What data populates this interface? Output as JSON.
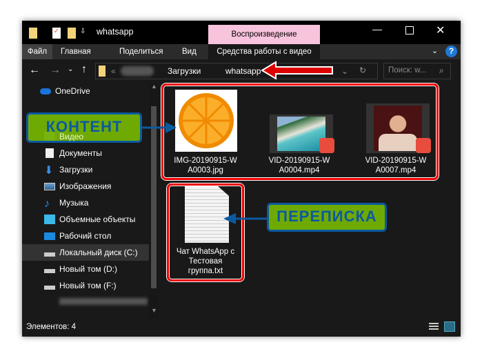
{
  "window": {
    "title": "whatsapp",
    "context_tab": "Воспроизведение",
    "context_color": "#f8c3dc"
  },
  "ribbon": {
    "tabs": [
      "Файл",
      "Главная",
      "Поделиться",
      "Вид",
      "Средства работы с видео"
    ]
  },
  "address": {
    "path": [
      "Загрузки",
      "whatsapp"
    ],
    "search_placeholder": "Поиск: w..."
  },
  "sidebar": {
    "items": [
      {
        "label": "OneDrive",
        "icon": "cloud-icon"
      },
      {
        "label": "Видео",
        "icon": "video-folder-icon"
      },
      {
        "label": "Документы",
        "icon": "documents-icon"
      },
      {
        "label": "Загрузки",
        "icon": "downloads-icon"
      },
      {
        "label": "Изображения",
        "icon": "pictures-icon"
      },
      {
        "label": "Музыка",
        "icon": "music-icon"
      },
      {
        "label": "Объемные объекты",
        "icon": "3d-objects-icon"
      },
      {
        "label": "Рабочий стол",
        "icon": "desktop-icon"
      },
      {
        "label": "Локальный диск (C:)",
        "icon": "drive-icon"
      },
      {
        "label": "Новый том (D:)",
        "icon": "drive-icon"
      },
      {
        "label": "Новый том (F:)",
        "icon": "drive-icon"
      }
    ]
  },
  "files": [
    {
      "name_line1": "IMG-20190915-W",
      "name_line2": "A0003.jpg",
      "type": "image"
    },
    {
      "name_line1": "VID-20190915-W",
      "name_line2": "A0004.mp4",
      "type": "video"
    },
    {
      "name_line1": "VID-20190915-W",
      "name_line2": "A0007.mp4",
      "type": "video"
    },
    {
      "name_line1": "Чат WhatsApp с",
      "name_line2": "Тестовая",
      "name_line3": "группа.txt",
      "type": "text"
    }
  ],
  "annotations": {
    "content": "КОНТЕНТ",
    "chat": "ПЕРЕПИСКА"
  },
  "status": {
    "count": "Элементов: 4"
  }
}
